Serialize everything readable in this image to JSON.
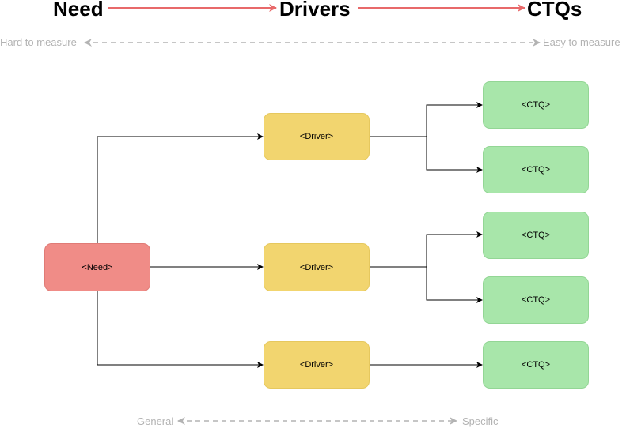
{
  "header": {
    "stages": [
      "Need",
      "Drivers",
      "CTQs"
    ],
    "arrow_color": "#e8696a"
  },
  "measure_scale": {
    "left_label": "Hard to measure",
    "right_label": "Easy to measure"
  },
  "specificity_scale": {
    "left_label": "General",
    "right_label": "Specific"
  },
  "nodes": {
    "need": {
      "label": "<Need>",
      "color": "#f08c87"
    },
    "drivers": [
      {
        "label": "<Driver>"
      },
      {
        "label": "<Driver>"
      },
      {
        "label": "<Driver>"
      }
    ],
    "ctqs": [
      {
        "label": "<CTQ>"
      },
      {
        "label": "<CTQ>"
      },
      {
        "label": "<CTQ>"
      },
      {
        "label": "<CTQ>"
      },
      {
        "label": "<CTQ>"
      }
    ],
    "driver_color": "#f2d56f",
    "ctq_color": "#a8e6aa"
  }
}
